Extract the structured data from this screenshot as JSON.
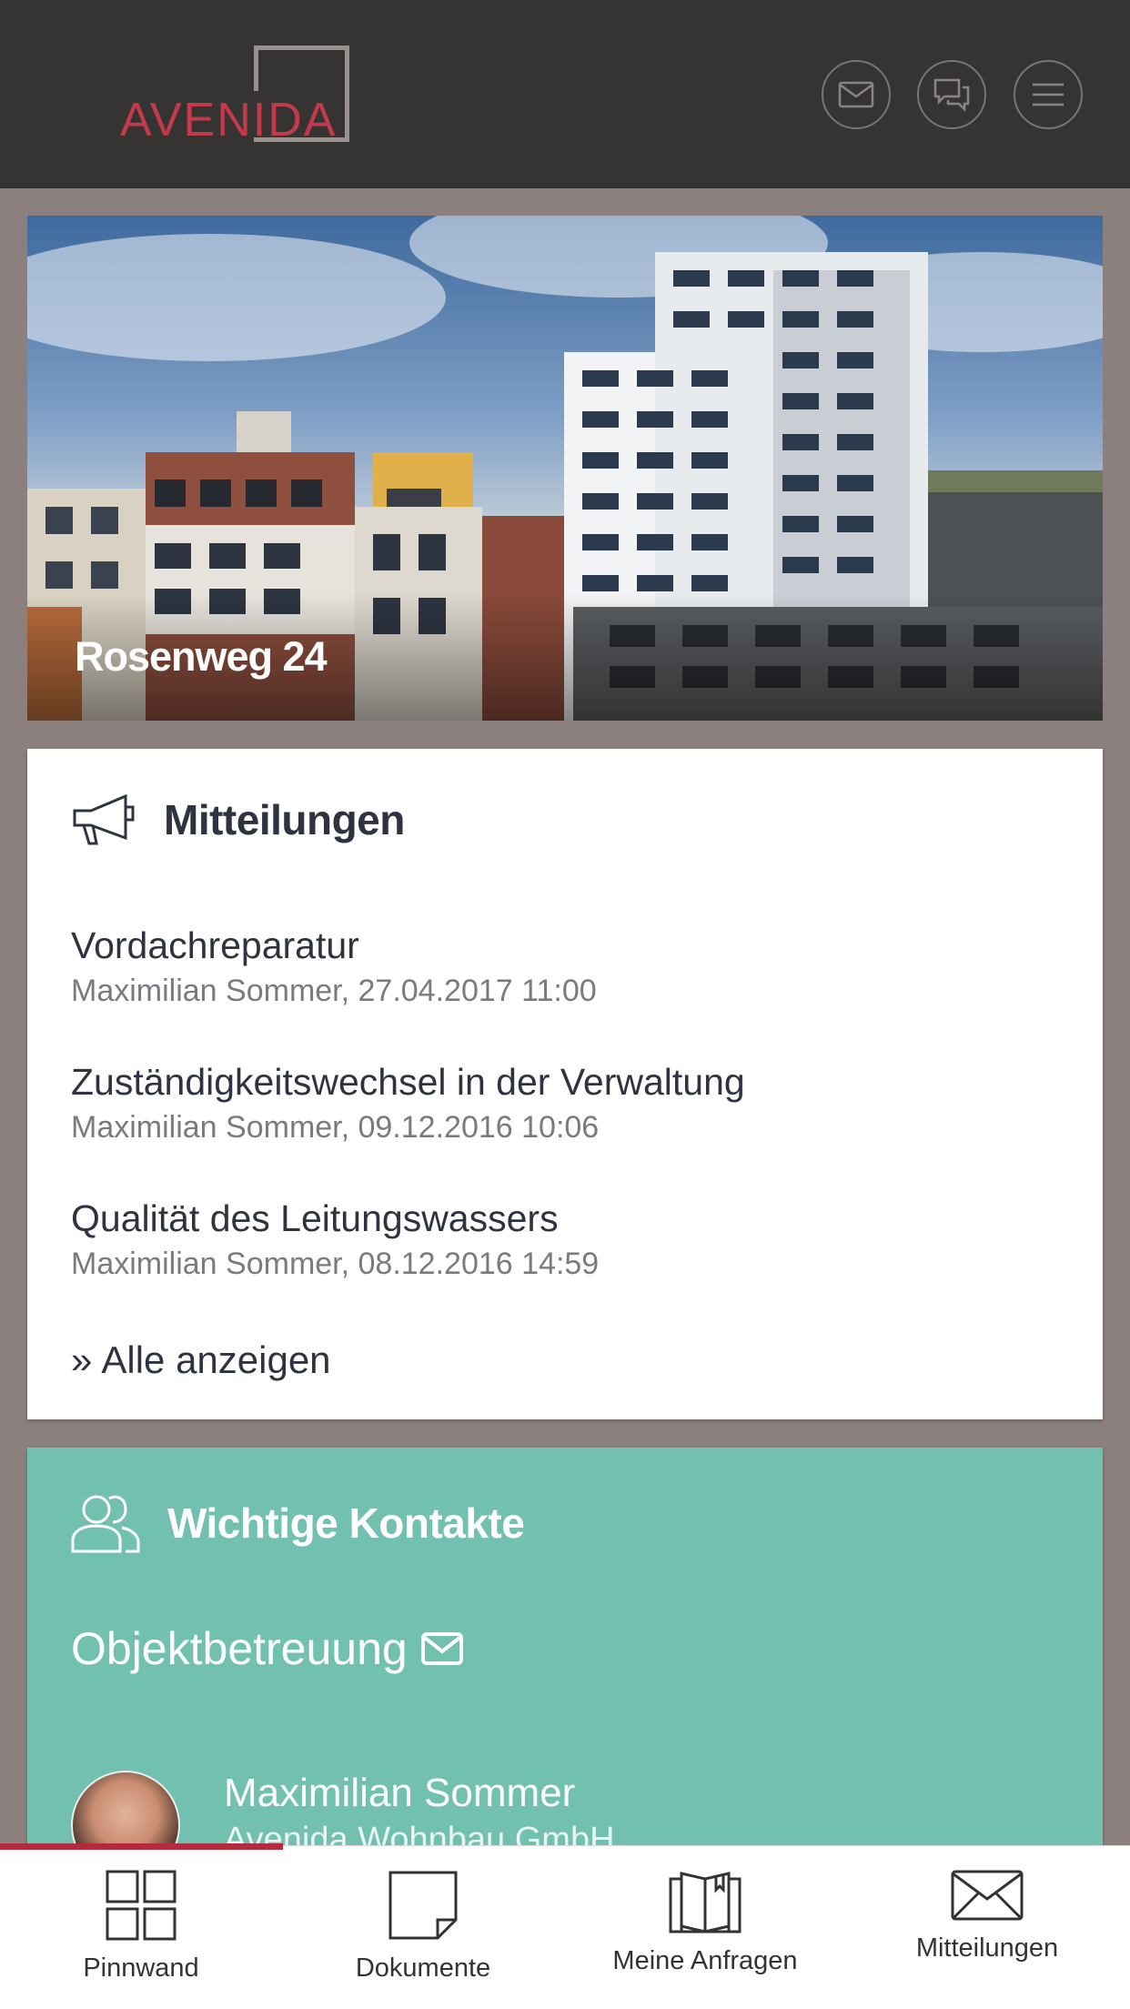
{
  "header": {
    "logo_text": "AVENIDA",
    "buttons": [
      {
        "icon": "envelope-icon"
      },
      {
        "icon": "chat-icon"
      },
      {
        "icon": "menu-icon"
      }
    ]
  },
  "hero": {
    "title": "Rosenweg 24"
  },
  "mitteilungen": {
    "title": "Mitteilungen",
    "icon": "megaphone-icon",
    "items": [
      {
        "subject": "Vordachreparatur",
        "meta": "Maximilian Sommer, 27.04.2017 11:00"
      },
      {
        "subject": "Zuständigkeitswechsel in der Verwaltung",
        "meta": "Maximilian Sommer, 09.12.2016 10:06"
      },
      {
        "subject": "Qualität des Leitungswassers",
        "meta": "Maximilian Sommer, 08.12.2016 14:59"
      }
    ],
    "all_link": "Alle anzeigen",
    "all_link_glyph": "»"
  },
  "kontakte": {
    "title": "Wichtige Kontakte",
    "icon": "users-icon",
    "section": "Objektbetreuung",
    "contact": {
      "name": "Maximilian Sommer",
      "org": "Avenida Wohnbau GmbH"
    }
  },
  "tabbar": {
    "active_index": 0,
    "active_color": "#b52a3d",
    "tabs": [
      {
        "label": "Pinnwand",
        "icon": "grid-icon"
      },
      {
        "label": "Dokumente",
        "icon": "document-icon"
      },
      {
        "label": "Meine Anfragen",
        "icon": "folder-icon"
      },
      {
        "label": "Mitteilungen",
        "icon": "envelope-icon"
      }
    ]
  },
  "colors": {
    "header_bg": "#363433",
    "page_bg": "#8b807d",
    "brand": "#c23a4c",
    "contacts_bg": "#71c0b0"
  }
}
